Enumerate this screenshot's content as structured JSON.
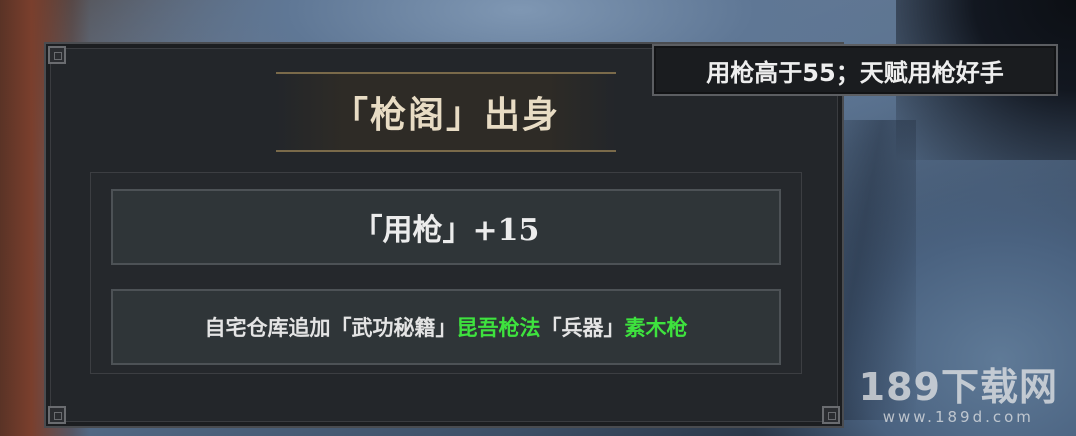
{
  "requirement": {
    "text": "用枪高于55；天赋用枪好手"
  },
  "origin_card": {
    "title": "「枪阁」出身",
    "stat_bonus": "「用枪」+15",
    "reward": {
      "prefix": "自宅仓库追加「武功秘籍」",
      "skill_book": "昆吾枪法",
      "mid": "「兵器」",
      "weapon": "素木枪"
    }
  },
  "watermark": {
    "main": "189下载网",
    "sub": "www.189d.com"
  },
  "colors": {
    "highlight_green": "#3ee23e",
    "title_gold": "#e8dcc4",
    "panel_bg": "#23262a"
  }
}
